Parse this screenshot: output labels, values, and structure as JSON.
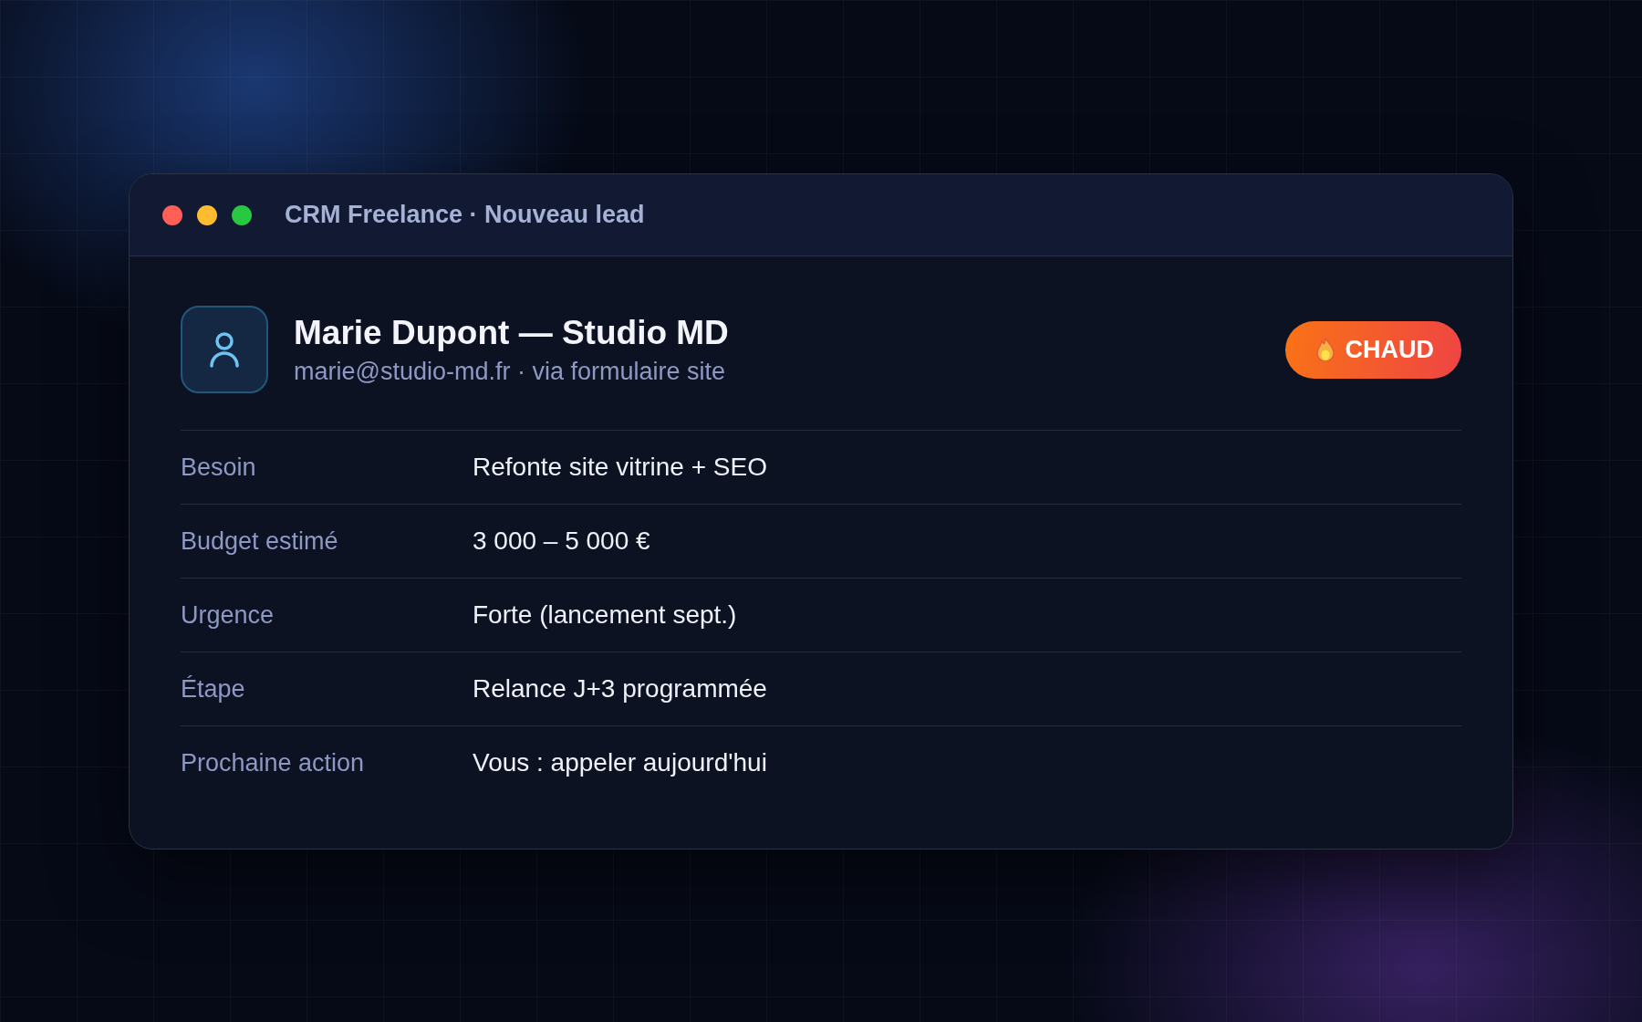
{
  "window": {
    "title": "CRM Freelance · Nouveau lead"
  },
  "lead": {
    "name": "Marie Dupont — Studio MD",
    "subtitle": "marie@studio-md.fr · via formulaire site",
    "badge": {
      "label": "CHAUD"
    }
  },
  "fields": [
    {
      "label": "Besoin",
      "value": "Refonte site vitrine + SEO"
    },
    {
      "label": "Budget estimé",
      "value": "3 000 – 5 000 €"
    },
    {
      "label": "Urgence",
      "value": "Forte (lancement sept.)"
    },
    {
      "label": "Étape",
      "value": "Relance J+3 programmée"
    },
    {
      "label": "Prochaine action",
      "value": "Vous : appeler aujourd'hui"
    }
  ]
}
